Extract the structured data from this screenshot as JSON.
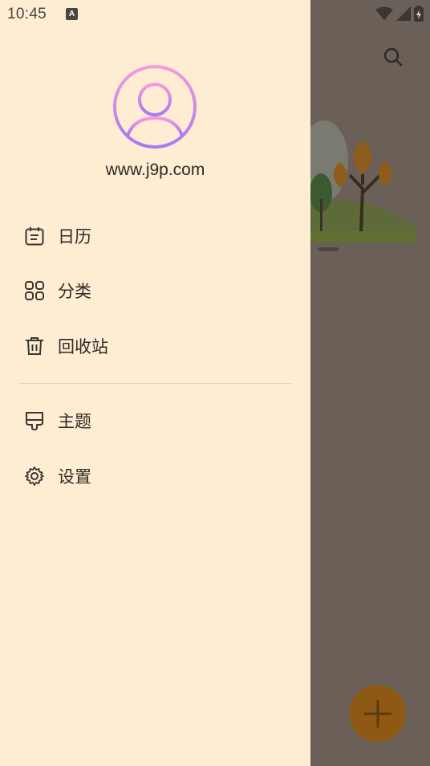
{
  "status_bar": {
    "time": "10:45",
    "notification_icon": "keyboard-a-icon",
    "icons": [
      "wifi-icon",
      "signal-icon",
      "battery-charging-icon"
    ]
  },
  "drawer": {
    "profile": {
      "avatar_icon": "user-avatar-icon",
      "username": "www.j9p.com"
    },
    "menu_primary": [
      {
        "icon": "calendar-icon",
        "label": "日历"
      },
      {
        "icon": "category-grid-icon",
        "label": "分类"
      },
      {
        "icon": "trash-icon",
        "label": "回收站"
      }
    ],
    "menu_secondary": [
      {
        "icon": "theme-icon",
        "label": "主题"
      },
      {
        "icon": "settings-gear-icon",
        "label": "设置"
      }
    ]
  },
  "background_app": {
    "search_icon": "search-icon",
    "illustration": "tree-landscape-illustration",
    "fab_icon": "add-icon"
  },
  "colors": {
    "drawer_bg": "#feecd3",
    "scrim": "#6a6057",
    "text": "#2f2b27",
    "icon": "#3b3632",
    "avatar_gradient_start": "#f49ae0",
    "avatar_gradient_end": "#a77af0",
    "fab": "#8e5a13"
  }
}
